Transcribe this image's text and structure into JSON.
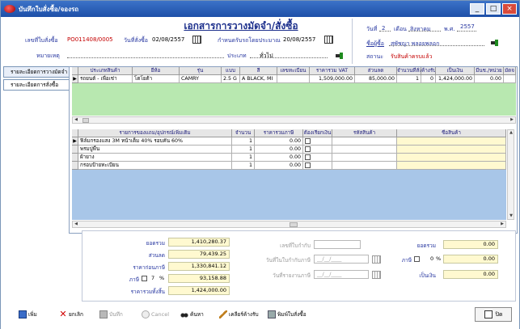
{
  "window": {
    "title": "บันทึกใบสั่งซื้อ/จองรถ",
    "min_glyph": "_",
    "max_glyph": "□",
    "close_glyph": "×"
  },
  "header": {
    "doc_title": "เอกสารการวางมัดจำ/สั่งซื้อ",
    "po_no_label": "เลขที่ใบสั่งซื้อ",
    "po_no_value": "PO011408/0005",
    "order_date_label": "วันที่สั่งซื้อ",
    "order_date_value": "02/08/2557",
    "due_date_label": "กำหนดรับรถโดยประมาณ",
    "due_date_value": "20/08/2557",
    "remark_label": "หมายเหตุ",
    "type_label": "ประเภท",
    "type_value": "ทั่วไป",
    "day_label": "วันที่",
    "day_value": "2",
    "month_label": "เดือน",
    "month_value": "สิงหาคม",
    "year_label": "พ.ศ.",
    "year_value": "2557",
    "buyer_label": "ชื่อผู้ซื้อ",
    "buyer_value": "สุพัชญา พลอยพลอก",
    "status_label": "สถานะ",
    "status_value": "รับสินค้าครบแล้ว"
  },
  "tabs": [
    {
      "label": "รายละเอียดการวางมัดจำ"
    },
    {
      "label": "รายละเอียดการสั่งซื้อ"
    }
  ],
  "product_grid": {
    "columns": [
      "ประเภทสินค้า",
      "ยี่ห้อ",
      "รุ่น",
      "แบบ",
      "สี",
      "เลขทะเบียน",
      "ราคารวม VAT",
      "ส่วนลด",
      "จำนวนที่สั่ง",
      "ค้างรับ",
      "เป็นเงิน",
      "มีนช./หน่วย",
      "มัดจ"
    ],
    "rows": [
      {
        "row_marker": "▶",
        "cells": [
          "รถยนต์ - เพื่อเช่า",
          "โตโยต้า",
          "CAMRY",
          "2.5 G",
          "A BLACK, MI",
          "",
          "1,509,000.00",
          "85,000.00",
          "1",
          "0",
          "1,424,000.00",
          "0.00",
          ""
        ]
      }
    ]
  },
  "accessory_grid": {
    "columns": [
      "รายการของแถม/อุปกรณ์เพิ่มเติม",
      "จำนวน",
      "ราคารวมภาษี",
      "ต้องเรียกเงิน",
      "รหัสสินค้า",
      "ชื่อสินค้า"
    ],
    "rows": [
      {
        "row_marker": "▶",
        "cells": [
          "ฟิล์มกรองแสง 3M หน้าเต็ม 40% รอบคัน 60%",
          "1",
          "0.00",
          "",
          "",
          ""
        ]
      },
      {
        "row_marker": "",
        "cells": [
          "พรมปูพื้น",
          "1",
          "0.00",
          "",
          "",
          ""
        ]
      },
      {
        "row_marker": "",
        "cells": [
          "ผ้ายาง",
          "1",
          "0.00",
          "",
          "",
          ""
        ]
      },
      {
        "row_marker": "",
        "cells": [
          "กรอบป้ายทะเบียน",
          "1",
          "0.00",
          "",
          "",
          ""
        ]
      }
    ]
  },
  "summary": {
    "total_label": "ยอดรวม",
    "total_value": "1,410,280.37",
    "discount_label": "ส่วนลด",
    "discount_value": "79,439.25",
    "pretax_label": "ราคาก่อนภาษี",
    "pretax_value": "1,330,841.12",
    "tax_label": "ภาษี",
    "tax_rate": "7",
    "percent_sign": "%",
    "tax_value": "93,158.88",
    "grand_label": "ราคารวมทั้งสิ้น",
    "grand_value": "1,424,000.00",
    "invoice_no_label": "เลขที่ใบกำกับ",
    "invoice_date_label": "วันที่ในใบกำกับภาษี",
    "invoice_date_placeholder": "__/__/____",
    "tax_record_date_label": "วันที่รายงานภาษี",
    "tax_record_date_placeholder": "__/__/____",
    "right_total_label": "ยอดรวม",
    "right_total_value": "0.00",
    "right_tax_label": "ภาษี",
    "right_tax_rate": "0",
    "right_tax_value": "0.00",
    "right_money_label": "เป็นเงิน",
    "right_money_value": "0.00"
  },
  "toolbar": {
    "add_label": "เพิ่ม",
    "cancel_doc_label": "ยกเลิก",
    "save_label": "บันทึก",
    "cancel_label": "Cancel",
    "search_label": "ค้นหา",
    "clear_label": "เคลียร์ค้างรับ",
    "print_label": "พิมพ์ใบสั่งซื้อ",
    "close_label": "ปิด"
  },
  "icons": {
    "app": "app-icon",
    "calendar": "calendar-icon",
    "pin": "pin-icon"
  }
}
